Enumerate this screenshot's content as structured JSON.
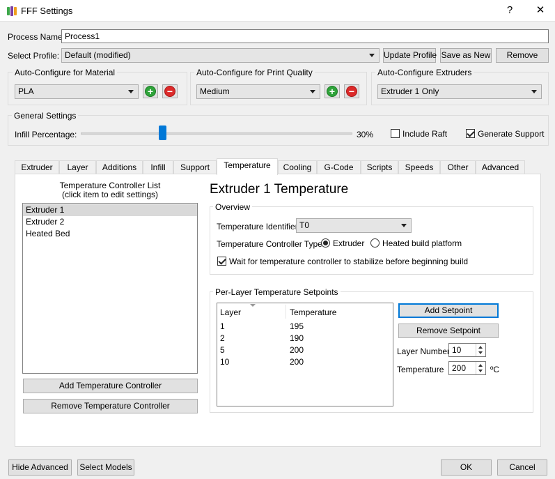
{
  "window": {
    "title": "FFF Settings",
    "help_glyph": "?",
    "close_glyph": "✕"
  },
  "process": {
    "label": "Process Name:",
    "value": "Process1"
  },
  "profile": {
    "label": "Select Profile:",
    "value": "Default (modified)",
    "update_label": "Update Profile",
    "save_new_label": "Save as New",
    "remove_label": "Remove"
  },
  "auto_material": {
    "title": "Auto-Configure for Material",
    "value": "PLA"
  },
  "auto_quality": {
    "title": "Auto-Configure for Print Quality",
    "value": "Medium"
  },
  "auto_extruders": {
    "title": "Auto-Configure Extruders",
    "value": "Extruder 1 Only"
  },
  "general": {
    "title": "General Settings",
    "infill_label": "Infill Percentage:",
    "infill_value": 30,
    "infill_text": "30%",
    "raft_label": "Include Raft",
    "raft_checked": false,
    "support_label": "Generate Support",
    "support_checked": true
  },
  "tabs": [
    {
      "label": "Extruder"
    },
    {
      "label": "Layer"
    },
    {
      "label": "Additions"
    },
    {
      "label": "Infill"
    },
    {
      "label": "Support"
    },
    {
      "label": "Temperature"
    },
    {
      "label": "Cooling"
    },
    {
      "label": "G-Code"
    },
    {
      "label": "Scripts"
    },
    {
      "label": "Speeds"
    },
    {
      "label": "Other"
    },
    {
      "label": "Advanced"
    }
  ],
  "active_tab": "Temperature",
  "temp_list": {
    "heading_line1": "Temperature Controller List",
    "heading_line2": "(click item to edit settings)",
    "items": [
      {
        "label": "Extruder 1"
      },
      {
        "label": "Extruder 2"
      },
      {
        "label": "Heated Bed"
      }
    ],
    "add_label": "Add Temperature Controller",
    "remove_label": "Remove Temperature Controller"
  },
  "detail": {
    "heading": "Extruder 1 Temperature",
    "overview_title": "Overview",
    "identifier_label": "Temperature Identifier",
    "identifier_value": "T0",
    "type_label": "Temperature Controller Type:",
    "type_extruder": "Extruder",
    "type_platform": "Heated build platform",
    "wait_label": "Wait for temperature controller to stabilize before beginning build",
    "wait_checked": true
  },
  "setpoints": {
    "title": "Per-Layer Temperature Setpoints",
    "col_layer": "Layer",
    "col_temp": "Temperature",
    "rows": [
      {
        "layer": "1",
        "temp": "195"
      },
      {
        "layer": "2",
        "temp": "190"
      },
      {
        "layer": "5",
        "temp": "200"
      },
      {
        "layer": "10",
        "temp": "200"
      }
    ],
    "add_label": "Add Setpoint",
    "remove_label": "Remove Setpoint",
    "layer_number_label": "Layer Number",
    "layer_number_value": "10",
    "temperature_label": "Temperature",
    "temperature_value": "200",
    "unit": "ºC"
  },
  "footer": {
    "hide_advanced": "Hide Advanced",
    "select_models": "Select Models",
    "ok": "OK",
    "cancel": "Cancel"
  },
  "colors": {
    "plus": "#2fa33a",
    "minus": "#dc2a2a",
    "slider_thumb": "#0078d7",
    "focus": "#0078d7"
  }
}
